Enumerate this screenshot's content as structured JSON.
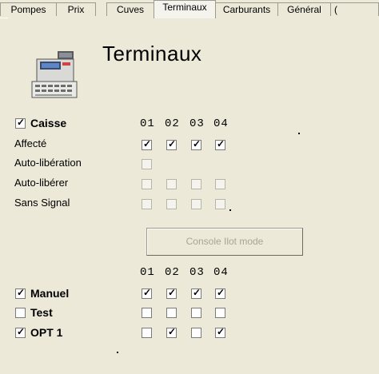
{
  "tabs": [
    "Pompes",
    "Prix",
    "Cuves",
    "Terminaux",
    "Carburants",
    "Général",
    "("
  ],
  "title": "Terminaux",
  "section1": {
    "caisse_label": "Caisse",
    "caisse_checked": true,
    "columns": [
      "01",
      "02",
      "03",
      "04"
    ],
    "rows": [
      {
        "label": "Affecté",
        "values": [
          true,
          true,
          true,
          true
        ],
        "enabled": [
          true,
          true,
          true,
          true
        ]
      },
      {
        "label": "Auto-libération",
        "values": [
          false
        ],
        "enabled": [
          false
        ]
      },
      {
        "label": "Auto-libérer",
        "values": [
          false,
          false,
          false,
          false
        ],
        "enabled": [
          false,
          false,
          false,
          false
        ]
      },
      {
        "label": "Sans Signal",
        "values": [
          false,
          false,
          false,
          false
        ],
        "enabled": [
          false,
          false,
          false,
          false
        ]
      }
    ]
  },
  "console_button": "Console Ilot mode",
  "section2": {
    "columns": [
      "01",
      "02",
      "03",
      "04"
    ],
    "rows": [
      {
        "label": "Manuel",
        "checked": true,
        "values": [
          true,
          true,
          true,
          true
        ]
      },
      {
        "label": "Test",
        "checked": false,
        "values": [
          false,
          false,
          false,
          false
        ]
      },
      {
        "label": "OPT 1",
        "checked": true,
        "values": [
          false,
          true,
          false,
          true
        ]
      }
    ]
  },
  "colors": {
    "window_bg": "#ECE9D8",
    "disabled_text": "#a8a596"
  }
}
